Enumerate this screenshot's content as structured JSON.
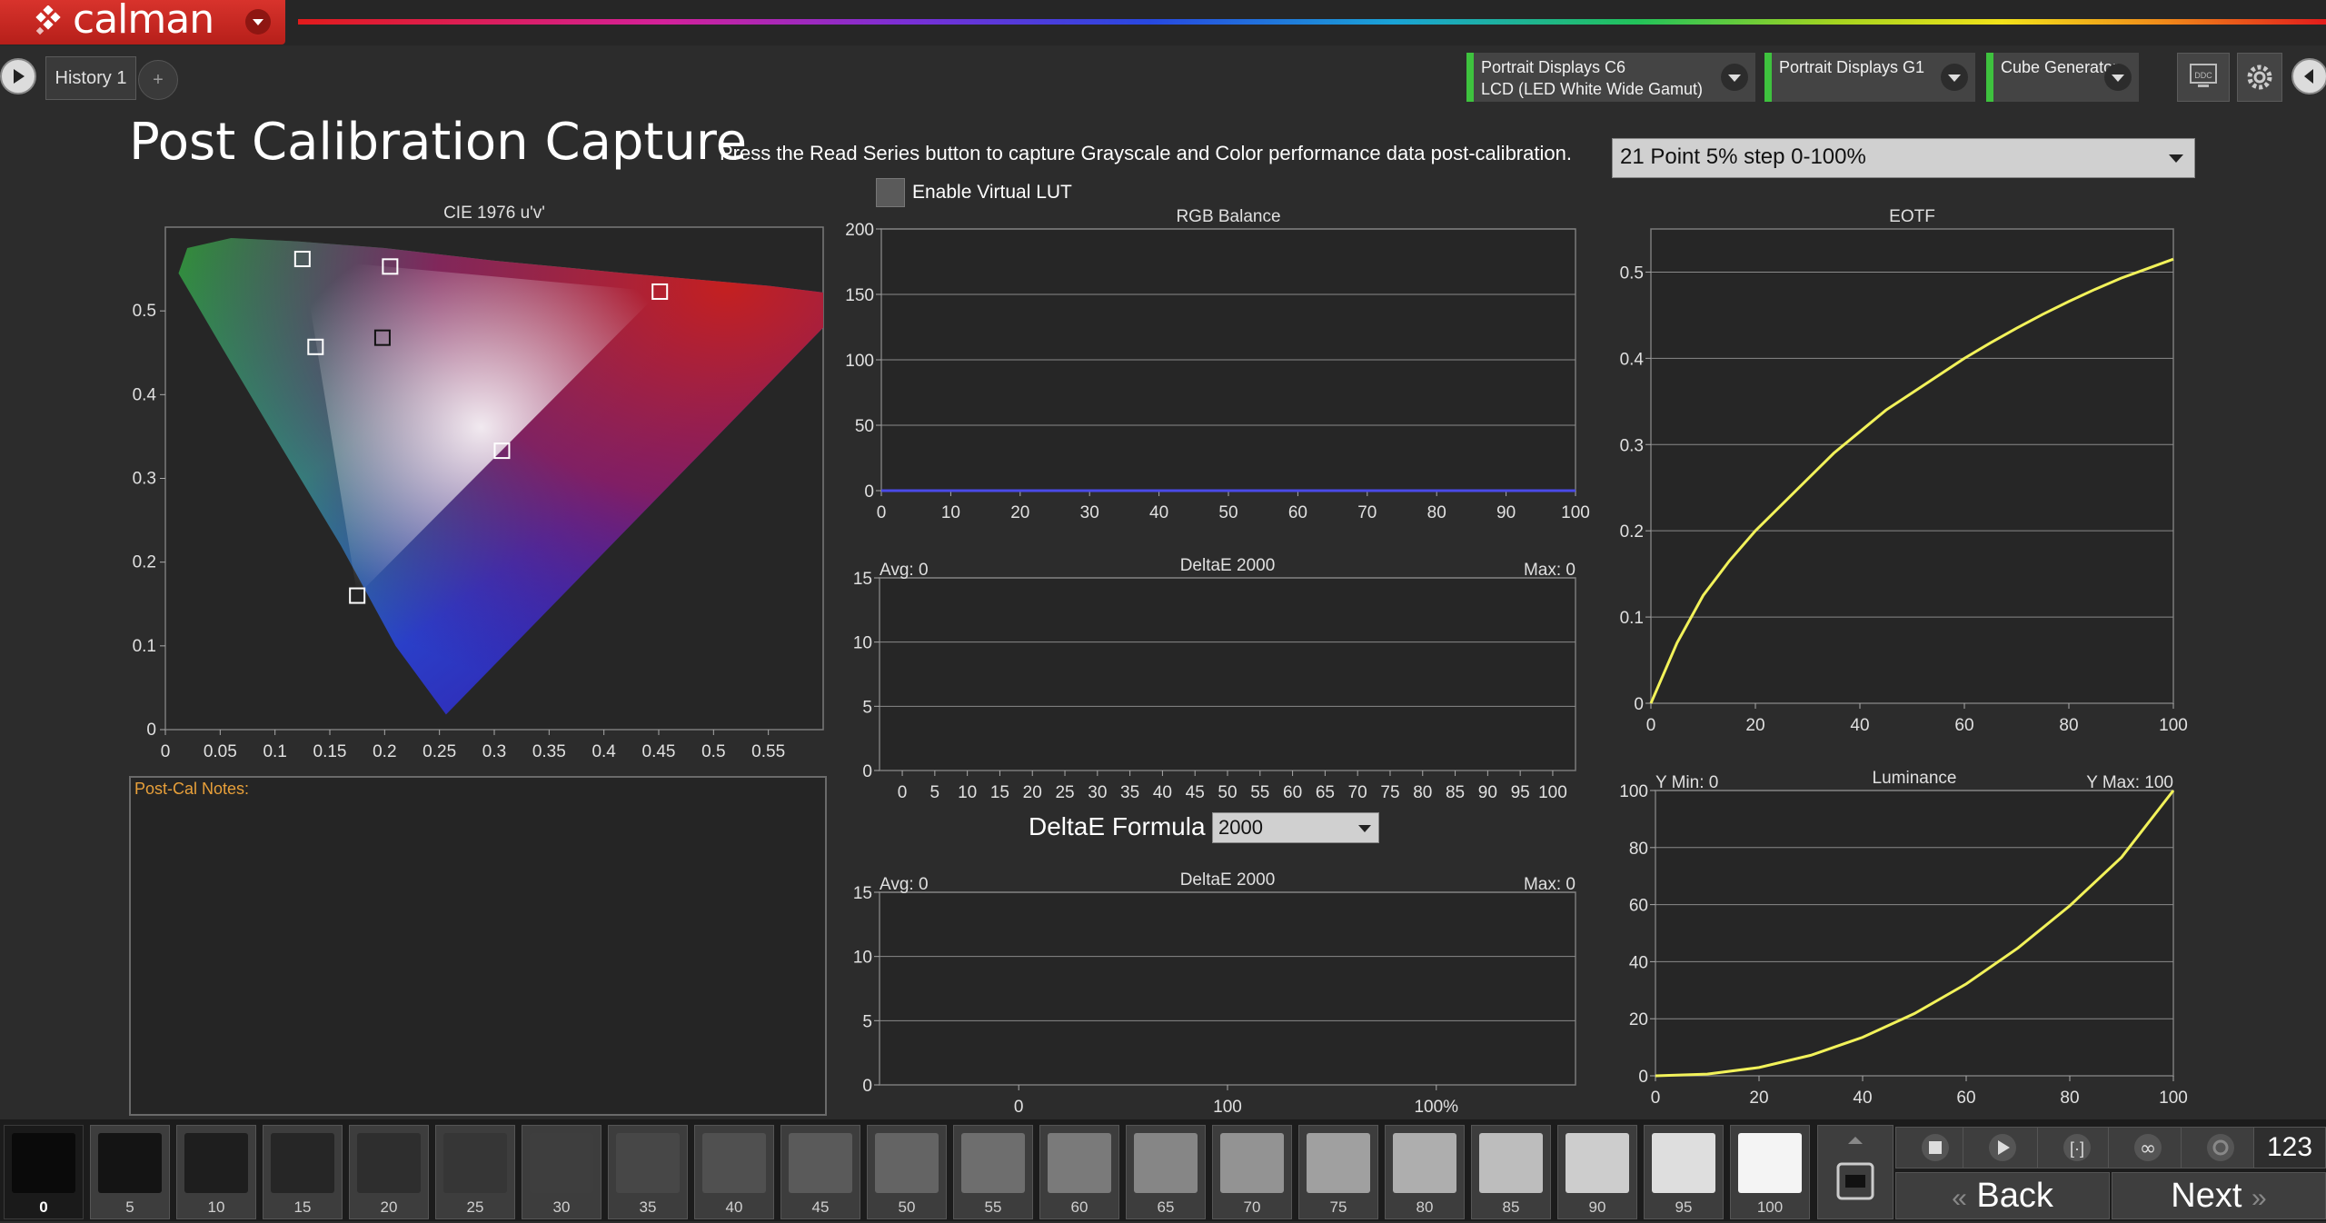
{
  "app": {
    "logo_text": "calman"
  },
  "tabs": {
    "history_label": "History 1",
    "add_label": "+"
  },
  "devices": [
    {
      "line1": "Portrait Displays C6",
      "line2": "LCD (LED White Wide Gamut)"
    },
    {
      "line1": "Portrait Displays G1",
      "line2": ""
    },
    {
      "line1": "Cube Generator",
      "line2": ""
    }
  ],
  "ddc_label": "DDC",
  "page": {
    "title": "Post Calibration Capture",
    "instruction": "Press the Read Series button to capture Grayscale and Color performance data post-calibration.",
    "series_select": "21 Point 5% step 0-100%",
    "virtual_lut_label": "Enable Virtual LUT",
    "notes_label": "Post-Cal Notes:",
    "deltae_formula_label": "DeltaE Formula",
    "deltae_formula_value": "2000"
  },
  "colors": {
    "accent": "#d8332c",
    "status_green": "#3ec23e",
    "curve": "#f2f25a",
    "notes_label": "#e8a03a"
  },
  "chart_data": [
    {
      "id": "cie",
      "type": "scatter",
      "title": "CIE 1976 u'v'",
      "x_ticks": [
        "0",
        "0.05",
        "0.1",
        "0.15",
        "0.2",
        "0.25",
        "0.3",
        "0.35",
        "0.4",
        "0.45",
        "0.5",
        "0.55"
      ],
      "y_ticks": [
        "0",
        "0.1",
        "0.2",
        "0.3",
        "0.4",
        "0.5"
      ],
      "xlim": [
        0,
        0.6
      ],
      "ylim": [
        0,
        0.6
      ],
      "points": [
        {
          "u": 0.125,
          "v": 0.562
        },
        {
          "u": 0.205,
          "v": 0.553
        },
        {
          "u": 0.451,
          "v": 0.523
        },
        {
          "u": 0.137,
          "v": 0.457
        },
        {
          "u": 0.198,
          "v": 0.468
        },
        {
          "u": 0.307,
          "v": 0.333
        },
        {
          "u": 0.175,
          "v": 0.16
        }
      ]
    },
    {
      "id": "rgb",
      "type": "line",
      "title": "RGB Balance",
      "x_ticks": [
        "0",
        "10",
        "20",
        "30",
        "40",
        "50",
        "60",
        "70",
        "80",
        "90",
        "100"
      ],
      "y_ticks": [
        "0",
        "50",
        "100",
        "150",
        "200"
      ],
      "xlim": [
        0,
        100
      ],
      "ylim": [
        0,
        200
      ],
      "series": [
        {
          "values_flat": 0,
          "color": "#4a4ae8"
        }
      ]
    },
    {
      "id": "de1",
      "type": "bar",
      "title": "DeltaE 2000",
      "avg_label": "Avg: 0",
      "max_label": "Max: 0",
      "x_ticks": [
        "0",
        "5",
        "10",
        "15",
        "20",
        "25",
        "30",
        "35",
        "40",
        "45",
        "50",
        "55",
        "60",
        "65",
        "70",
        "75",
        "80",
        "85",
        "90",
        "95",
        "100"
      ],
      "y_ticks": [
        "0",
        "5",
        "10",
        "15"
      ],
      "ylim": [
        0,
        15
      ]
    },
    {
      "id": "de2",
      "type": "bar",
      "title": "DeltaE 2000",
      "avg_label": "Avg: 0",
      "max_label": "Max: 0",
      "x_ticks": [
        "0",
        "100",
        "100%"
      ],
      "y_ticks": [
        "0",
        "5",
        "10",
        "15"
      ],
      "ylim": [
        0,
        15
      ]
    },
    {
      "id": "eotf",
      "type": "line",
      "title": "EOTF",
      "x_ticks": [
        "0",
        "20",
        "40",
        "60",
        "80",
        "100"
      ],
      "y_ticks": [
        "0",
        "0.1",
        "0.2",
        "0.3",
        "0.4",
        "0.5"
      ],
      "xlim": [
        0,
        100
      ],
      "ylim": [
        0,
        0.55
      ],
      "x": [
        0,
        5,
        10,
        15,
        20,
        25,
        30,
        35,
        40,
        45,
        50,
        55,
        60,
        65,
        70,
        75,
        80,
        85,
        90,
        95,
        100
      ],
      "y": [
        0,
        0.07,
        0.125,
        0.165,
        0.2,
        0.23,
        0.26,
        0.29,
        0.315,
        0.34,
        0.36,
        0.38,
        0.4,
        0.418,
        0.435,
        0.451,
        0.466,
        0.48,
        0.493,
        0.504,
        0.515
      ]
    },
    {
      "id": "lum",
      "type": "line",
      "title": "Luminance",
      "ymin_label": "Y Min: 0",
      "ymax_label": "Y Max: 100",
      "x_ticks": [
        "0",
        "20",
        "40",
        "60",
        "80",
        "100"
      ],
      "y_ticks": [
        "0",
        "20",
        "40",
        "60",
        "80",
        "100"
      ],
      "xlim": [
        0,
        100
      ],
      "ylim": [
        0,
        100
      ],
      "x": [
        0,
        10,
        20,
        30,
        40,
        50,
        60,
        70,
        80,
        90,
        100
      ],
      "y": [
        0,
        0.6,
        2.9,
        7.2,
        13.5,
        21.8,
        32.2,
        44.8,
        59.6,
        76.6,
        100
      ]
    }
  ],
  "swatches": [
    {
      "label": "0",
      "gray": "#0a0a0a"
    },
    {
      "label": "5",
      "gray": "#141414"
    },
    {
      "label": "10",
      "gray": "#1e1e1e"
    },
    {
      "label": "15",
      "gray": "#262626"
    },
    {
      "label": "20",
      "gray": "#2e2e2e"
    },
    {
      "label": "25",
      "gray": "#363636"
    },
    {
      "label": "30",
      "gray": "#3e3e3e"
    },
    {
      "label": "35",
      "gray": "#474747"
    },
    {
      "label": "40",
      "gray": "#505050"
    },
    {
      "label": "45",
      "gray": "#5a5a5a"
    },
    {
      "label": "50",
      "gray": "#646464"
    },
    {
      "label": "55",
      "gray": "#6e6e6e"
    },
    {
      "label": "60",
      "gray": "#7a7a7a"
    },
    {
      "label": "65",
      "gray": "#868686"
    },
    {
      "label": "70",
      "gray": "#939393"
    },
    {
      "label": "75",
      "gray": "#a0a0a0"
    },
    {
      "label": "80",
      "gray": "#aeaeae"
    },
    {
      "label": "85",
      "gray": "#bdbdbd"
    },
    {
      "label": "90",
      "gray": "#cdcdcd"
    },
    {
      "label": "95",
      "gray": "#dedede"
    },
    {
      "label": "100",
      "gray": "#f4f4f4"
    }
  ],
  "controls": {
    "counter": "123",
    "back_label": "Back",
    "next_label": "Next"
  }
}
